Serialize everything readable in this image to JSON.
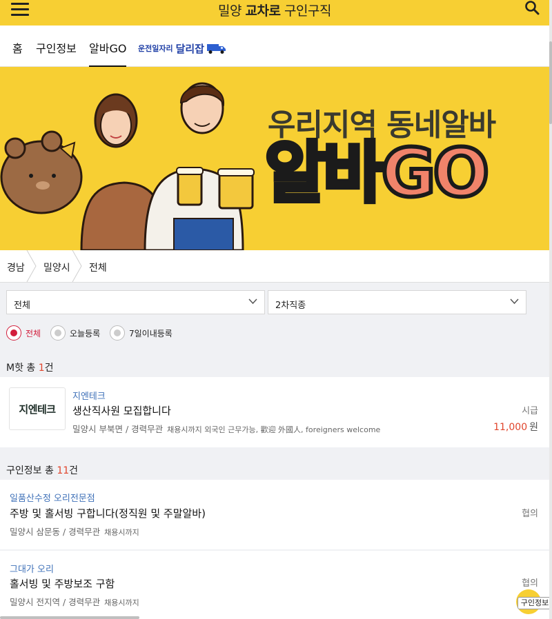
{
  "header": {
    "title_part1": "밀양",
    "title_part2": "교차로",
    "title_part3": "구인구직",
    "menu_icon": "hamburger-menu-icon",
    "search_icon": "search-icon",
    "bg_color": "#f7cf33"
  },
  "nav": {
    "tabs": [
      {
        "label": "홈"
      },
      {
        "label": "구인정보"
      },
      {
        "label": "알바GO",
        "active": true
      }
    ],
    "promo_small": "운전일자리",
    "promo_big": "달리잡",
    "promo_icon": "truck-icon"
  },
  "banner": {
    "line1": "우리지역 동네알바",
    "line2_a": "알바",
    "line2_b": "GO"
  },
  "breadcrumb": [
    "경남",
    "밀양시",
    "전체"
  ],
  "filters": {
    "select1": "전체",
    "select2": "2차직종",
    "radios": [
      {
        "label": "전체",
        "checked": true
      },
      {
        "label": "오늘등록",
        "checked": false
      },
      {
        "label": "7일이내등록",
        "checked": false
      }
    ]
  },
  "hot_section": {
    "prefix": "M핫 총 ",
    "count": "1",
    "suffix": "건"
  },
  "hot_listings": [
    {
      "logo_text": "지엔테크",
      "company": "지엔테크",
      "title": "생산직사원 모집합니다",
      "location": "밀양시 부북면 / 경력무관",
      "extra": "채용시까지 외국인 근무가능, 歡迎 外國人, foreigners welcome",
      "pay_type": "시급",
      "pay_amount": "11,000",
      "pay_unit": "원"
    }
  ],
  "job_section": {
    "prefix": "구인정보 총 ",
    "count": "11",
    "suffix": "건"
  },
  "job_listings": [
    {
      "company": "일품산수정 오리전문점",
      "title": "주방 및 홀서빙 구합니다(정직원 및 주말알바)",
      "location": "밀양시 삼문동 / 경력무관",
      "extra": "채용시까지",
      "pay_type": "협의"
    },
    {
      "company": "그대가 오리",
      "title": "홀서빙 및 주방보조 구함",
      "location": "밀양시 전지역 / 경력무관",
      "extra": "채용시까지",
      "pay_type": "협의"
    }
  ],
  "floating_button": "구인정보"
}
